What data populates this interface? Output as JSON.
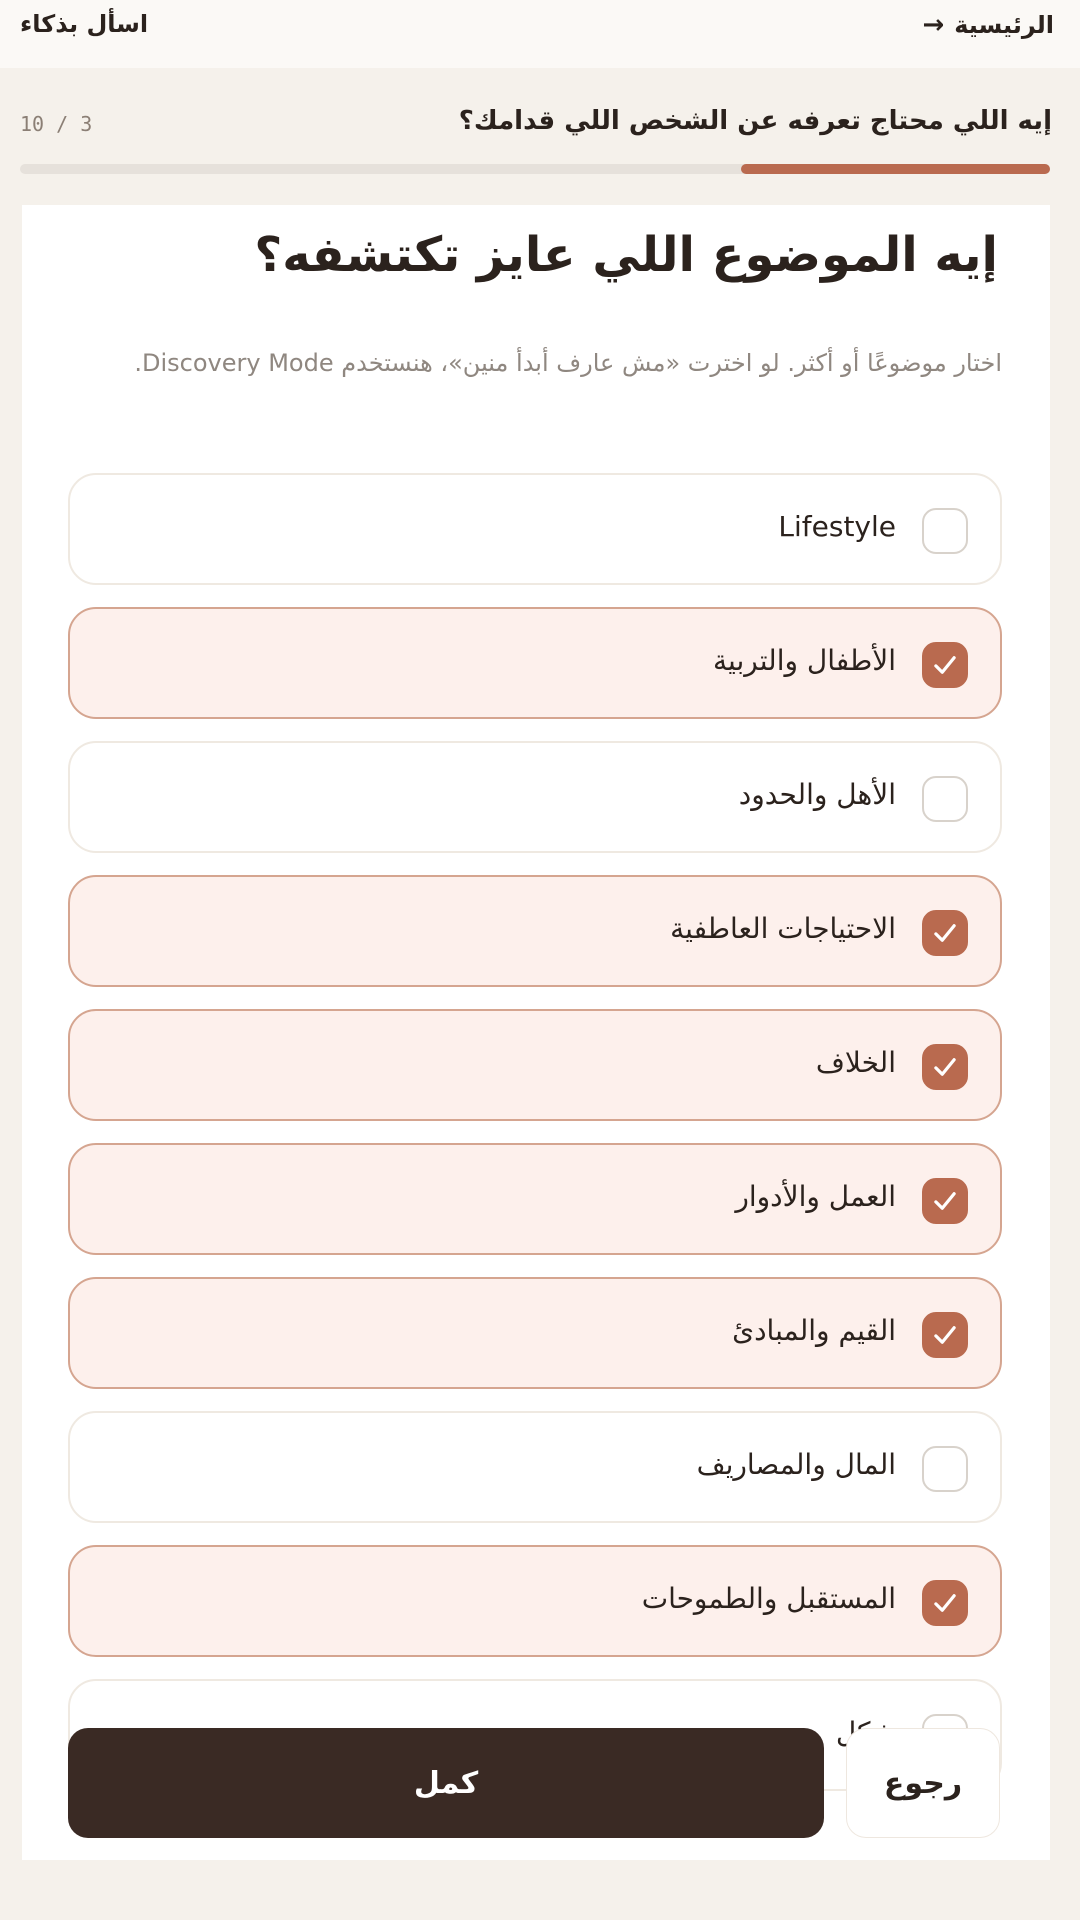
{
  "nav": {
    "home_label": "الرئيسية",
    "home_icon": "arrow-right-icon",
    "ask_label": "اسأل بذكاء"
  },
  "progress": {
    "question_title": "إيه اللي محتاج تعرفه عن الشخص اللي قدامك؟",
    "count_text": "10 / 3",
    "value": 0.3
  },
  "main": {
    "title": "إيه الموضوع اللي عايز تكتشفه؟",
    "description": "اختار موضوعًا أو أكثر. لو اخترت «مش عارف أبدأ منين»، هنستخدم Discovery Mode."
  },
  "options": [
    {
      "label": "Lifestyle",
      "checked": false
    },
    {
      "label": "الأطفال والتربية",
      "checked": true
    },
    {
      "label": "الأهل والحدود",
      "checked": false
    },
    {
      "label": "الاحتياجات العاطفية",
      "checked": true
    },
    {
      "label": "الخلاف",
      "checked": true
    },
    {
      "label": "العمل والأدوار",
      "checked": true
    },
    {
      "label": "القيم والمبادئ",
      "checked": true
    },
    {
      "label": "المال والمصاريف",
      "checked": false
    },
    {
      "label": "المستقبل والطموحات",
      "checked": true
    },
    {
      "label": "شكل",
      "checked": false
    }
  ],
  "buttons": {
    "next": "كمل",
    "back": "رجوع"
  },
  "colors": {
    "accent": "#b96a4f",
    "dark": "#3a2a24",
    "checked_bg": "#fdf0ec"
  }
}
